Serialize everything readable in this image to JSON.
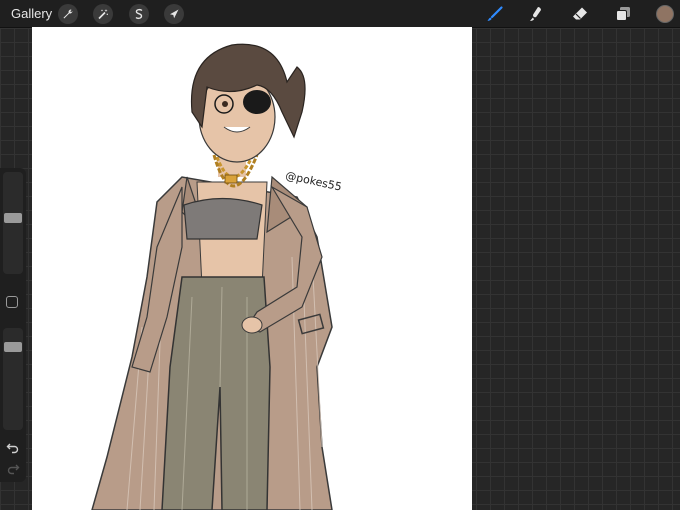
{
  "app": {
    "gallery_label": "Gallery"
  },
  "toolbar_left": [
    {
      "name": "actions",
      "icon": "wrench-icon"
    },
    {
      "name": "adjustments",
      "icon": "magic-wand-icon"
    },
    {
      "name": "selection",
      "icon": "selection-s-icon"
    },
    {
      "name": "transform",
      "icon": "arrow-cursor-icon"
    }
  ],
  "toolbar_right": [
    {
      "name": "brush",
      "icon": "brush-icon",
      "active": true
    },
    {
      "name": "smudge",
      "icon": "smudge-finger-icon",
      "active": false
    },
    {
      "name": "eraser",
      "icon": "eraser-icon",
      "active": false
    },
    {
      "name": "layers",
      "icon": "layers-icon",
      "active": false
    }
  ],
  "colors": {
    "active_color": "#8f7463",
    "accent": "#2f8bff",
    "canvas": "#ffffff"
  },
  "sidebar": {
    "brush_size_level": 0.55,
    "opacity_level": 0.85
  },
  "artwork": {
    "signature_text": "@pokes55"
  }
}
